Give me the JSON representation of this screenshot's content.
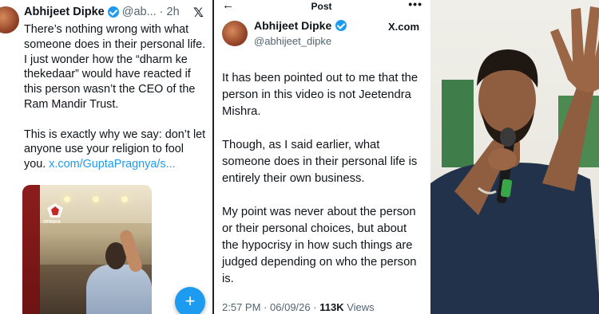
{
  "tweet_left": {
    "author_name": "Abhijeet Dipke",
    "handle": "@ab...",
    "separator": "·",
    "time": "2h",
    "platform_logo": "𝕏",
    "body": [
      "There’s nothing wrong with what someone does in their personal life. I just wonder how the “dharm ke thekedaar” would have reacted if this person wasn’t the CEO of the Ram Mandir Trust.",
      "This is exactly why we say: don’t let anyone use your religion to fool you."
    ],
    "link": "x.com/GuptaPragnya/s...",
    "media_watermark": "OPINDIA",
    "compose_icon": "+"
  },
  "tweet_right": {
    "nav_back_icon": "←",
    "nav_title": "Post",
    "nav_more_icon": "•••",
    "author_name": "Abhijeet Dipke",
    "handle": "@abhijeet_dipke",
    "platform_label": "X.com",
    "body": [
      "It has been pointed out to me that the person in this video is not Jeetendra Mishra.",
      "Though, as I said earlier, what someone does in their personal life is entirely their own business.",
      "My point was never about the person or their personal choices, but about the hypocrisy in how such things are judged depending on who the person is."
    ],
    "time": "2:57 PM",
    "separator": "·",
    "date": "06/09/26",
    "views_count": "113K",
    "views_label": "Views"
  },
  "colors": {
    "accent": "#1d9bf0",
    "text": "#0f1419",
    "muted": "#536471"
  }
}
